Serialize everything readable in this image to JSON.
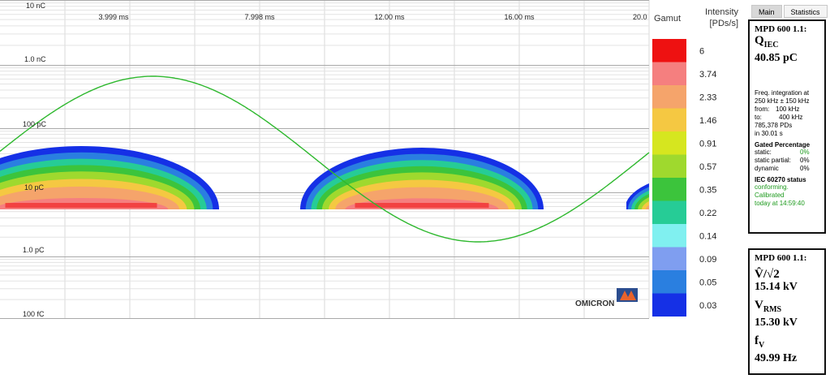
{
  "plot": {
    "x_ticks": [
      "3.999 ms",
      "7.998 ms",
      "12.00 ms",
      "16.00 ms",
      "20.0"
    ],
    "y_labels": [
      "10 nC",
      "1.0 nC",
      "100 pC",
      "10 pC",
      "1.0 pC",
      "100 fC"
    ],
    "watermark": "OMICRON",
    "colors": {
      "sine": "#2eb82e",
      "grid": "#d0d0d0",
      "decade_line": "#a9a9a9"
    }
  },
  "legend": {
    "gamut_label": "Gamut",
    "intensity_label": "Intensity",
    "intensity_unit": "[PDs/s]",
    "entries": [
      {
        "value": "6",
        "color": "#ee1111"
      },
      {
        "value": "3.74",
        "color": "#f57f7f"
      },
      {
        "value": "2.33",
        "color": "#f5a46b"
      },
      {
        "value": "1.46",
        "color": "#f5c842"
      },
      {
        "value": "0.91",
        "color": "#d6e61f"
      },
      {
        "value": "0.57",
        "color": "#9fd92e"
      },
      {
        "value": "0.35",
        "color": "#3cc43c"
      },
      {
        "value": "0.22",
        "color": "#26cc96"
      },
      {
        "value": "0.14",
        "color": "#80f0f0"
      },
      {
        "value": "0.09",
        "color": "#7f9ef0"
      },
      {
        "value": "0.05",
        "color": "#2a7fe0"
      },
      {
        "value": "0.03",
        "color": "#1530e6"
      }
    ]
  },
  "tabs": {
    "main": "Main",
    "statistics": "Statistics"
  },
  "panel1": {
    "title": "MPD 600 1.1:",
    "symbol_main": "Q",
    "symbol_sub": "IEC",
    "value": "40.85 pC",
    "freq_line1": "Freq. integration at",
    "freq_line2": "250 kHz ± 150 kHz",
    "from_label": "from:",
    "from_value": "100 kHz",
    "to_label": "to:",
    "to_value": "400 kHz",
    "pd_count": "785,378 PDs",
    "duration": "in 30.01 s",
    "gated_title": "Gated Percentage",
    "gated_rows": [
      {
        "label": "static:",
        "value": "0%",
        "green": true
      },
      {
        "label": "static partial:",
        "value": "0%",
        "green": false
      },
      {
        "label": "dynamic",
        "value": "0%",
        "green": false
      }
    ],
    "iec_title": "IEC 60270 status",
    "iec_status_line1": "conforming. Calibrated",
    "iec_status_line2": "today at 14:59:40"
  },
  "panel2": {
    "title": "MPD 600 1.1:",
    "v_peak_symbol": "V̂/√2",
    "v_peak_value": "15.14 kV",
    "v_rms_main": "V",
    "v_rms_sub": "RMS",
    "v_rms_value": "15.30 kV",
    "f_main": "f",
    "f_sub": "V",
    "f_value": "49.99 Hz"
  }
}
